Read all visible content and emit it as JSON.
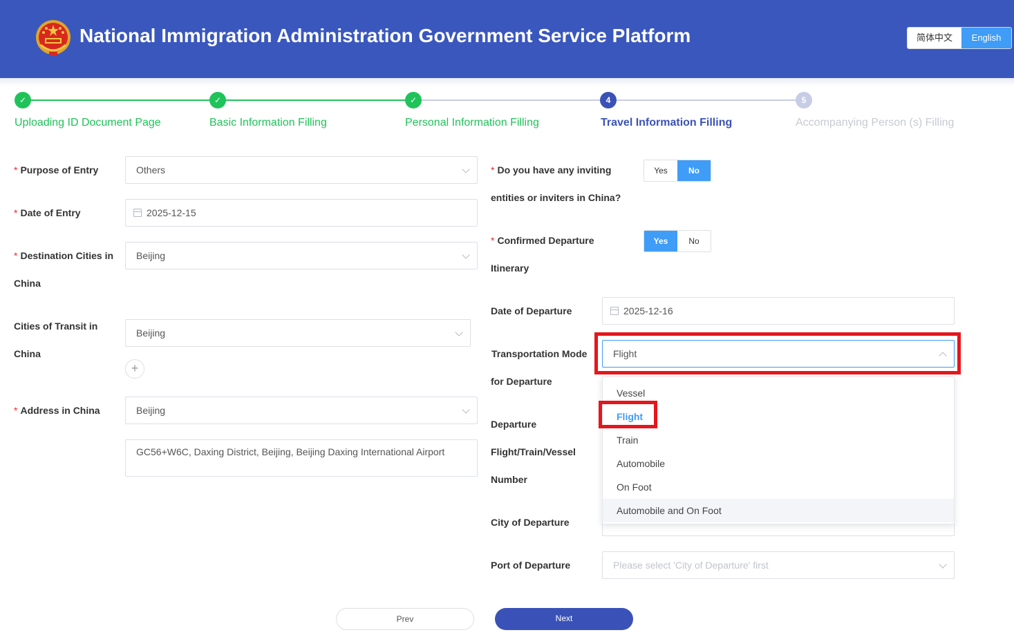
{
  "header": {
    "title": "National Immigration Administration Government Service Platform",
    "lang_zh": "简体中文",
    "lang_en": "English"
  },
  "steps": [
    {
      "num": "✓",
      "label": "Uploading ID Document Page",
      "state": "done"
    },
    {
      "num": "✓",
      "label": "Basic Information Filling",
      "state": "done"
    },
    {
      "num": "✓",
      "label": "Personal Information Filling",
      "state": "done"
    },
    {
      "num": "4",
      "label": "Travel Information Filling",
      "state": "current"
    },
    {
      "num": "5",
      "label": "Accompanying Person (s) Filling",
      "state": "future"
    }
  ],
  "form": {
    "purpose_label": "Purpose of Entry",
    "purpose_value": "Others",
    "entry_date_label": "Date of Entry",
    "entry_date_value": "2025-12-15",
    "dest_label_1": "Destination Cities in",
    "dest_label_2": "China",
    "dest_value": "Beijing",
    "transit_label_1": "Cities of Transit in",
    "transit_label_2": "China",
    "transit_value": "Beijing",
    "add_symbol": "+",
    "address_label": "Address in China",
    "address_value": "Beijing",
    "address_detail": "GC56+W6C, Daxing District, Beijing, Beijing Daxing International Airport",
    "inviting_label_1": "Do you have any inviting",
    "inviting_label_2": "entities or inviters in China?",
    "inviting_yes": "Yes",
    "inviting_no": "No",
    "inviting_selected": "No",
    "itinerary_label_1": "Confirmed Departure",
    "itinerary_label_2": "Itinerary",
    "itinerary_yes": "Yes",
    "itinerary_no": "No",
    "itinerary_selected": "Yes",
    "departure_date_label": "Date of Departure",
    "departure_date_value": "2025-12-16",
    "transport_label_1": "Transportation Mode",
    "transport_label_2": "for Departure",
    "transport_value": "Flight",
    "dep_number_label_1": "Departure",
    "dep_number_label_2": "Flight/Train/Vessel",
    "dep_number_label_3": "Number",
    "city_departure_label": "City of Departure",
    "port_departure_label": "Port of Departure",
    "port_departure_placeholder": "Please select 'City of Departure' first"
  },
  "dropdown": {
    "options": [
      "Vessel",
      "Flight",
      "Train",
      "Automobile",
      "On Foot",
      "Automobile and On Foot"
    ],
    "selected": "Flight",
    "hovered": "Automobile and On Foot"
  },
  "buttons": {
    "prev": "Prev",
    "next": "Next"
  },
  "colors": {
    "header_bg": "#3a57be",
    "accent_blue": "#3f9cf7",
    "step_done": "#1fc35a",
    "step_current": "#3a52b7",
    "highlight_red": "#e5161c"
  }
}
